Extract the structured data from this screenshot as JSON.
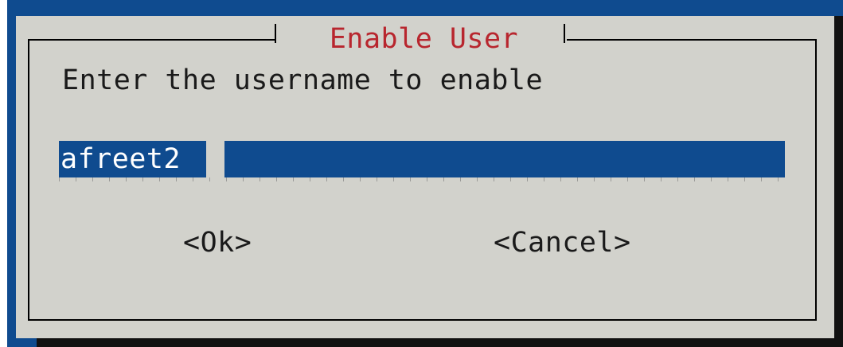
{
  "dialog": {
    "title": "Enable User",
    "prompt": "Enter the username to enable",
    "input_value": "afreet2",
    "ok_label": "<Ok>",
    "cancel_label": "<Cancel>"
  },
  "colors": {
    "terminal_background": "#0f4b8f",
    "dialog_background": "#d2d2cc",
    "title_text": "#b8262e",
    "input_background": "#0f4b8f",
    "input_text": "#ffffff",
    "body_text": "#1a1a1a",
    "shadow": "#111111"
  }
}
